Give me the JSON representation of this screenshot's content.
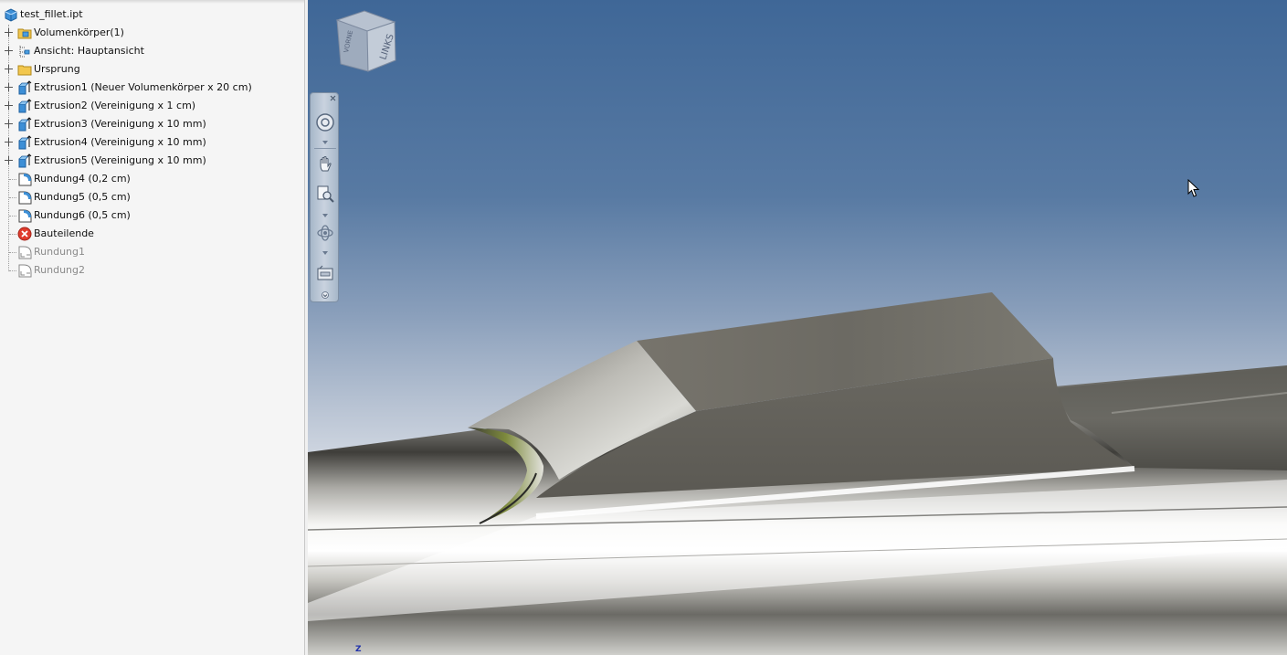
{
  "app": {
    "accent": "#3f6797"
  },
  "browser": {
    "root_label": "test_fillet.ipt",
    "items": [
      {
        "label": "Volumenkörper(1)",
        "icon": "folder-solid-icon",
        "expandable": true,
        "dim": false
      },
      {
        "label": "Ansicht: Hauptansicht",
        "icon": "view-representation-icon",
        "expandable": true,
        "dim": false
      },
      {
        "label": "Ursprung",
        "icon": "folder-icon",
        "expandable": true,
        "dim": false
      },
      {
        "label": "Extrusion1 (Neuer Volumenkörper x 20 cm)",
        "icon": "extrude-icon",
        "expandable": true,
        "dim": false
      },
      {
        "label": "Extrusion2 (Vereinigung x 1 cm)",
        "icon": "extrude-icon",
        "expandable": true,
        "dim": false
      },
      {
        "label": "Extrusion3 (Vereinigung x 10 mm)",
        "icon": "extrude-icon",
        "expandable": true,
        "dim": false
      },
      {
        "label": "Extrusion4 (Vereinigung x 10 mm)",
        "icon": "extrude-icon",
        "expandable": true,
        "dim": false
      },
      {
        "label": "Extrusion5 (Vereinigung x 10 mm)",
        "icon": "extrude-icon",
        "expandable": true,
        "dim": false
      },
      {
        "label": "Rundung4 (0,2 cm)",
        "icon": "fillet-icon",
        "expandable": false,
        "dim": false
      },
      {
        "label": "Rundung5 (0,5 cm)",
        "icon": "fillet-icon",
        "expandable": false,
        "dim": false
      },
      {
        "label": "Rundung6 (0,5 cm)",
        "icon": "fillet-icon",
        "expandable": false,
        "dim": false
      },
      {
        "label": "Bauteilende",
        "icon": "end-of-part-icon",
        "expandable": false,
        "dim": false
      },
      {
        "label": "Rundung1",
        "icon": "fillet-suppressed-icon",
        "expandable": false,
        "dim": true
      },
      {
        "label": "Rundung2",
        "icon": "fillet-suppressed-icon",
        "expandable": false,
        "dim": true
      }
    ]
  },
  "viewport": {
    "viewcube_face": "LINKS",
    "viewcube_side": "VORNE",
    "axis_label": "Z",
    "navbar_buttons": [
      "steering-wheel-icon",
      "pan-icon",
      "zoom-icon",
      "orbit-icon",
      "view-face-icon"
    ]
  }
}
